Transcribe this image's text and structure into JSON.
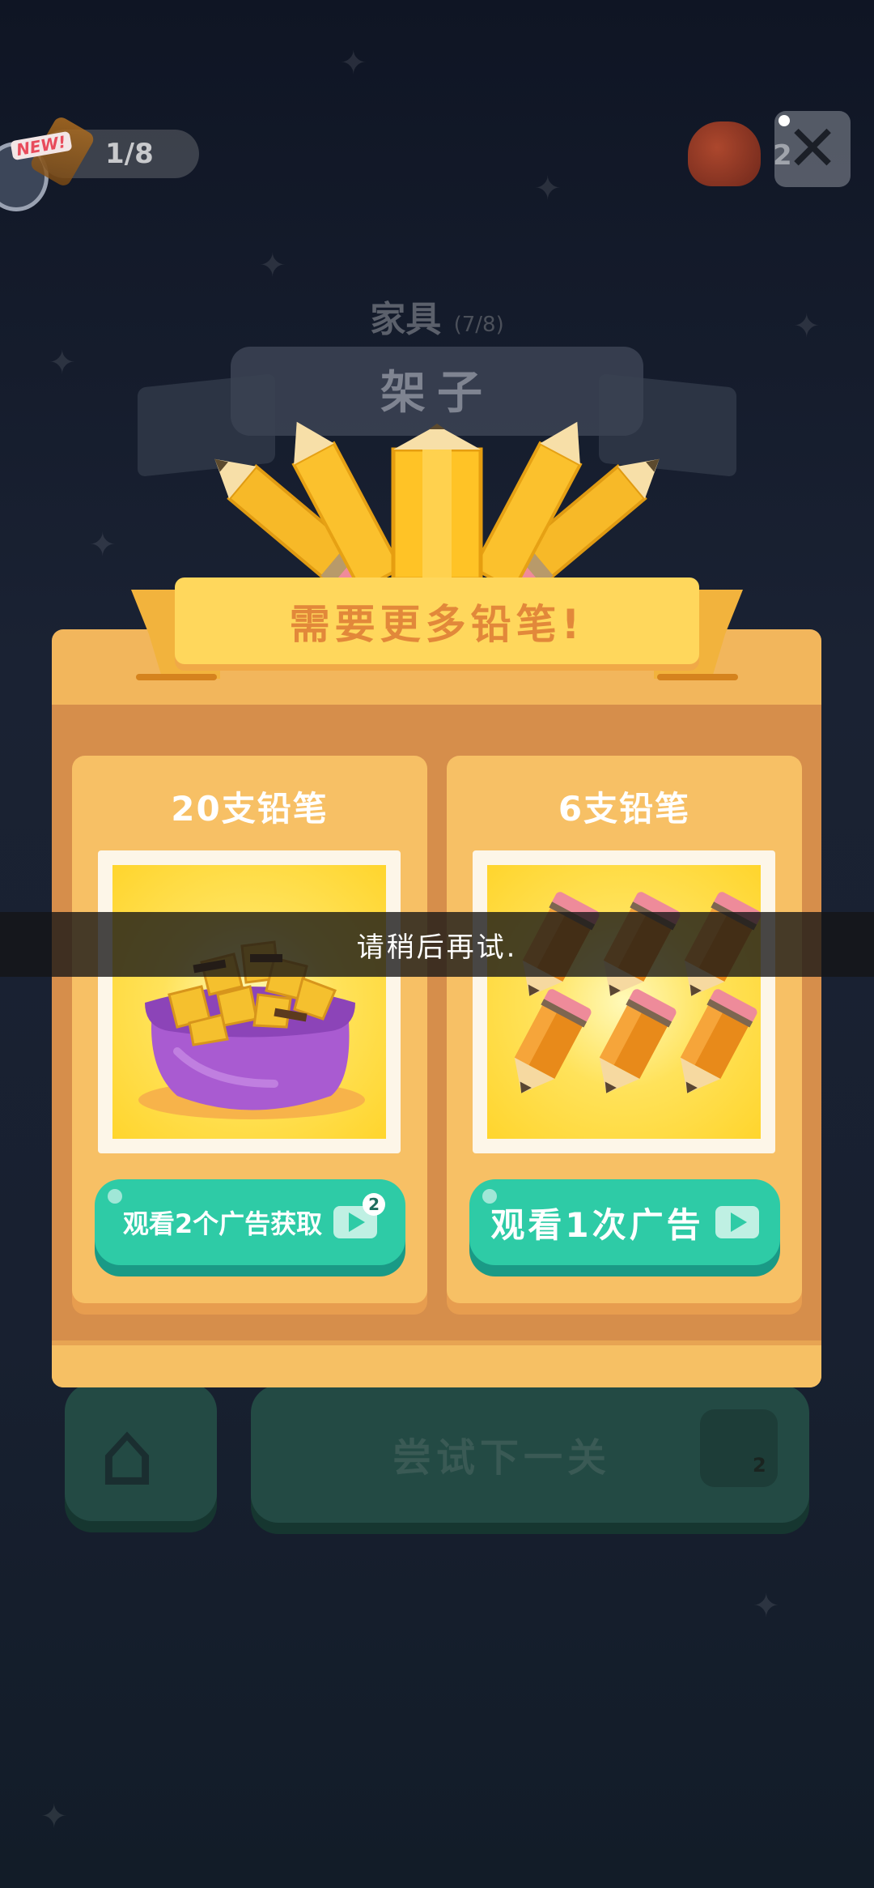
{
  "hud": {
    "new_badge": "NEW!",
    "collection_progress": "1/8",
    "coin_count": "2"
  },
  "level": {
    "category": "家具",
    "category_progress": "(7/8)",
    "word": "架子"
  },
  "modal": {
    "title": "需要更多铅笔!",
    "option_left": {
      "title": "20支铅笔",
      "button_label": "观看2个广告获取",
      "ad_count_badge": "2"
    },
    "option_right": {
      "title": "6支铅笔",
      "button_label": "观看1次广告"
    }
  },
  "footer": {
    "next_label": "尝试下一关",
    "pencil_cost": "2"
  },
  "toast": "请稍后再试.",
  "colors": {
    "panel": "#f2b65c",
    "panel_inner": "#d68e4b",
    "banner": "#ffd75c",
    "ad_button": "#2ecba6",
    "pencil": "#f7b928"
  }
}
